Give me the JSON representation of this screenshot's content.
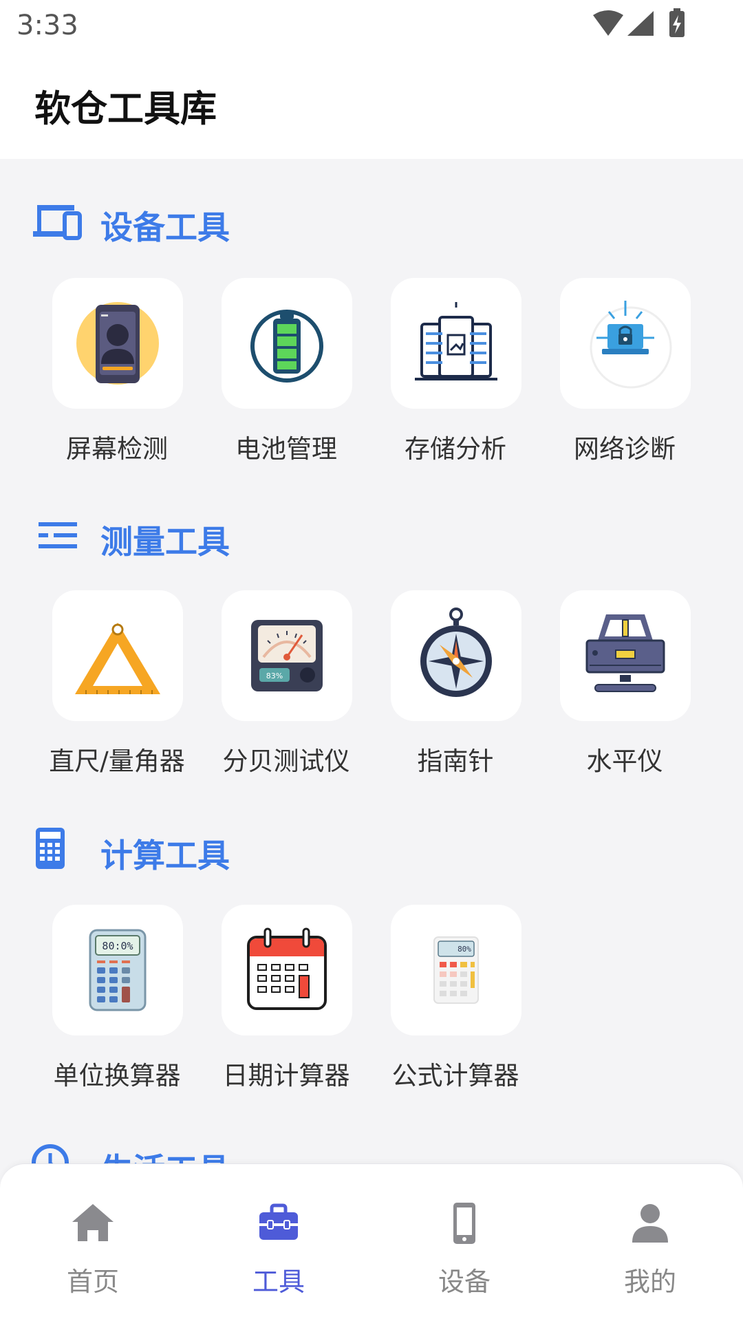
{
  "status": {
    "time": "3:33"
  },
  "app": {
    "title": "软仓工具库"
  },
  "sections": [
    {
      "title": "设备工具",
      "icon": "devices-icon",
      "tools": [
        {
          "label": "屏幕检测",
          "icon": "phone-screen-icon"
        },
        {
          "label": "电池管理",
          "icon": "battery-icon"
        },
        {
          "label": "存储分析",
          "icon": "storage-server-icon"
        },
        {
          "label": "网络诊断",
          "icon": "network-laptop-icon"
        }
      ]
    },
    {
      "title": "测量工具",
      "icon": "ruler-lines-icon",
      "tools": [
        {
          "label": "直尺/量角器",
          "icon": "triangle-ruler-icon"
        },
        {
          "label": "分贝测试仪",
          "icon": "decibel-meter-icon"
        },
        {
          "label": "指南针",
          "icon": "compass-icon"
        },
        {
          "label": "水平仪",
          "icon": "spirit-level-icon"
        }
      ]
    },
    {
      "title": "计算工具",
      "icon": "calculator-icon",
      "tools": [
        {
          "label": "单位换算器",
          "icon": "unit-calculator-icon",
          "display": "80:0%"
        },
        {
          "label": "日期计算器",
          "icon": "calendar-icon"
        },
        {
          "label": "公式计算器",
          "icon": "formula-calculator-icon",
          "display": "80%"
        }
      ]
    },
    {
      "title": "生活工具",
      "icon": "clock-icon",
      "tools": []
    }
  ],
  "decibel_display": "83%",
  "nav": {
    "items": [
      {
        "label": "首页",
        "icon": "home-icon"
      },
      {
        "label": "工具",
        "icon": "toolbox-icon"
      },
      {
        "label": "设备",
        "icon": "device-icon"
      },
      {
        "label": "我的",
        "icon": "user-icon"
      }
    ],
    "active_index": 1
  },
  "colors": {
    "accent": "#3d7be8",
    "nav_active": "#4e5bd8",
    "nav_inactive": "#888888",
    "background": "#f4f4f6"
  }
}
